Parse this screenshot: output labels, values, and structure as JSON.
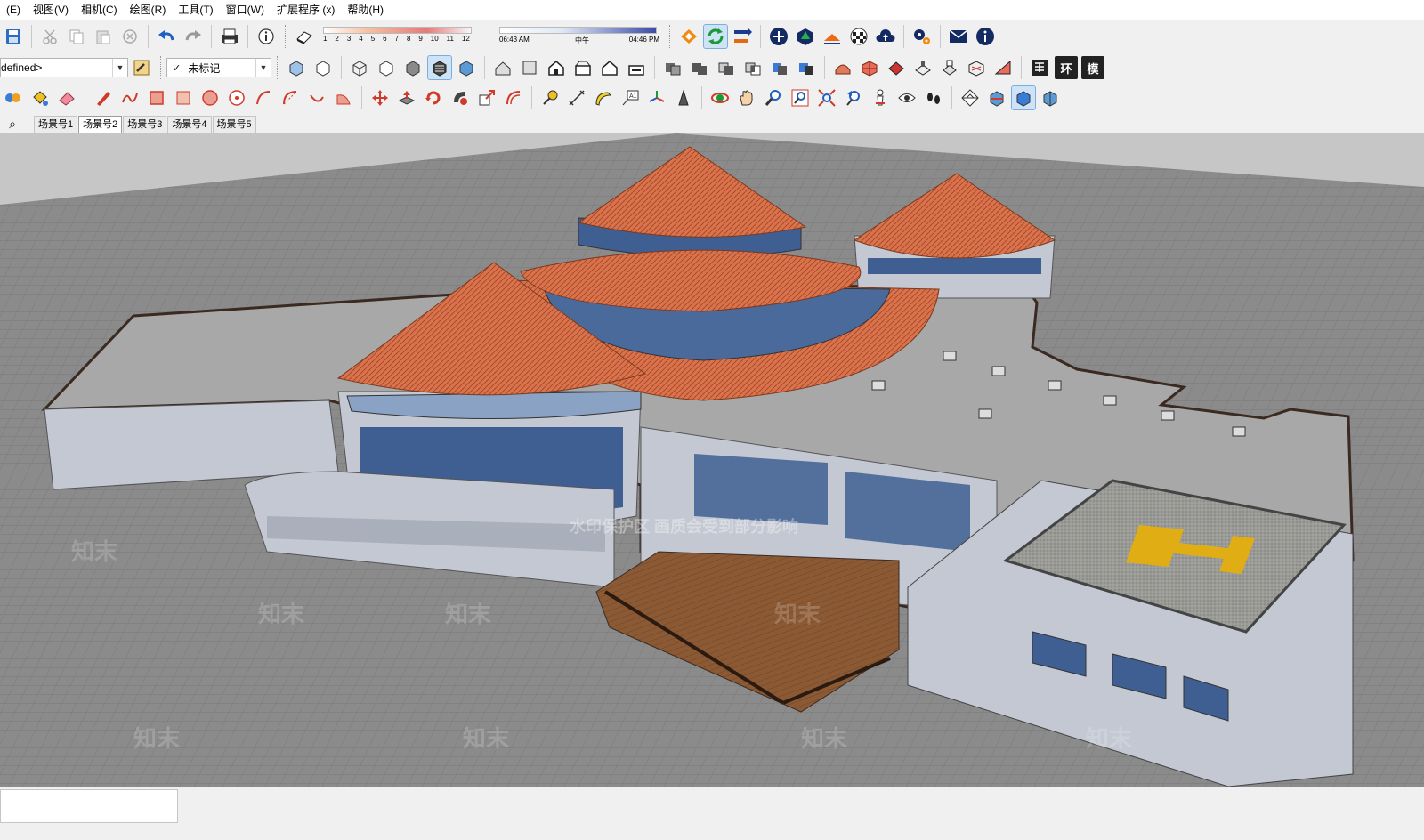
{
  "menu": [
    "(E)",
    "视图(V)",
    "相机(C)",
    "绘图(R)",
    "工具(T)",
    "窗口(W)",
    "扩展程序 (x)",
    "帮助(H)"
  ],
  "shadow": {
    "months": [
      "1",
      "2",
      "3",
      "4",
      "5",
      "6",
      "7",
      "8",
      "9",
      "10",
      "11",
      "12"
    ],
    "time_start": "06:43 AM",
    "time_mid": "中午",
    "time_end": "04:46 PM"
  },
  "layer_combo": {
    "value": "defined>"
  },
  "tag_combo": {
    "check": "✓",
    "value": "未标记"
  },
  "toolbar_labels": {
    "huan": "环",
    "mo": "模"
  },
  "scenes": {
    "search_glyph": "⌕",
    "tabs": [
      "场景号1",
      "场景号2",
      "场景号3",
      "场景号4",
      "场景号5"
    ],
    "active_index": 1
  },
  "watermark": {
    "notice": "水印保护区  画质会受到部分影响",
    "brand": "知末"
  },
  "colors": {
    "roof": "#d9734c",
    "roof_dark": "#b8502f",
    "wall": "#bfc4cf",
    "glass": "#3f5f93",
    "deck": "#8b5a34",
    "helipad": "#e0ad14",
    "ground": "#8a8a8a"
  }
}
